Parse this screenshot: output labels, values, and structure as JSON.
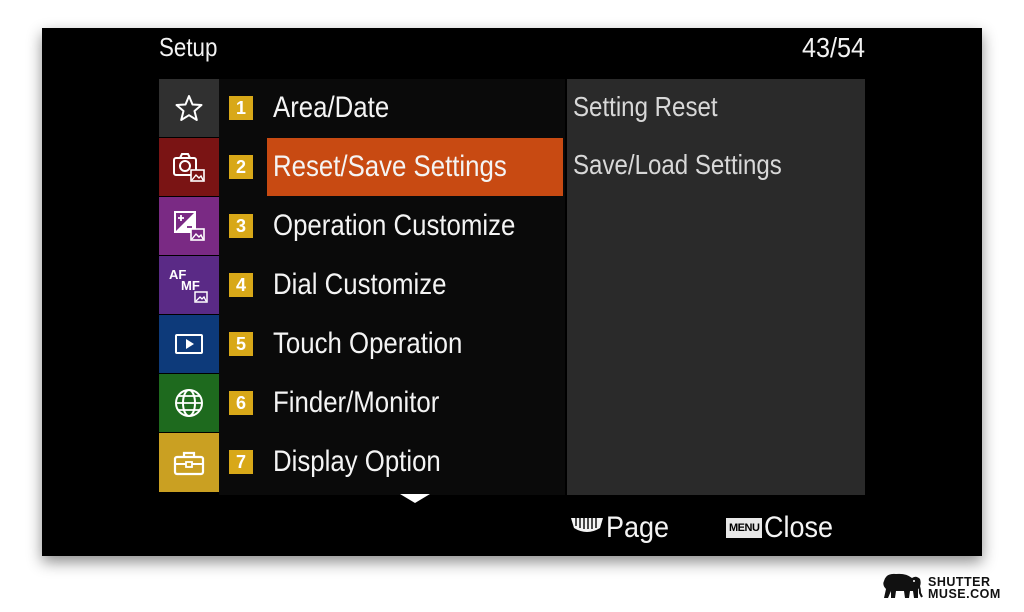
{
  "header": {
    "title": "Setup",
    "page_indicator": "43/54"
  },
  "categories": [
    {
      "icon": "star-icon",
      "color": "#303030"
    },
    {
      "icon": "camera-icon",
      "color": "#7a1414"
    },
    {
      "icon": "exposure-icon",
      "color": "#7a2a84"
    },
    {
      "icon": "af-mf-icon",
      "color": "#5a2a86",
      "text_top": "AF",
      "text_bottom": "MF"
    },
    {
      "icon": "playback-icon",
      "color": "#0d3a7a"
    },
    {
      "icon": "globe-icon",
      "color": "#1e6a1e"
    },
    {
      "icon": "toolbox-icon",
      "color": "#caa022",
      "selected": true
    }
  ],
  "menu": {
    "items": [
      {
        "number": "1",
        "label": "Area/Date"
      },
      {
        "number": "2",
        "label": "Reset/Save Settings",
        "selected": true
      },
      {
        "number": "3",
        "label": "Operation Customize"
      },
      {
        "number": "4",
        "label": "Dial Customize"
      },
      {
        "number": "5",
        "label": "Touch Operation"
      },
      {
        "number": "6",
        "label": "Finder/Monitor"
      },
      {
        "number": "7",
        "label": "Display Option"
      }
    ]
  },
  "detail": {
    "items": [
      "Setting Reset",
      "Save/Load Settings"
    ]
  },
  "footer": {
    "page_label": "Page",
    "menu_badge": "MENU",
    "close_label": "Close"
  },
  "watermark": {
    "line1": "SHUTTER",
    "line2": "MUSE.COM"
  }
}
